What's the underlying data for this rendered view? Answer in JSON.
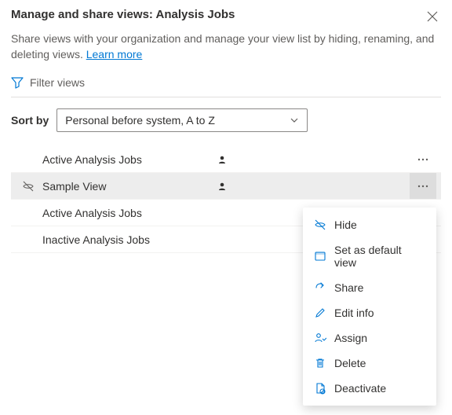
{
  "header": {
    "title": "Manage and share views: Analysis Jobs",
    "description_pre": "Share views with your organization and manage your view list by hiding, renaming, and deleting views. ",
    "learn_more": "Learn more"
  },
  "filter": {
    "label": "Filter views"
  },
  "sort": {
    "label": "Sort by",
    "selected": "Personal before system, A to Z"
  },
  "views": [
    {
      "label": "Active Analysis Jobs",
      "personal": true,
      "hidden": false,
      "more_visible": true,
      "hovered": false
    },
    {
      "label": "Sample View",
      "personal": true,
      "hidden": true,
      "more_visible": true,
      "hovered": true
    },
    {
      "label": "Active Analysis Jobs",
      "personal": false,
      "hidden": false,
      "more_visible": false,
      "hovered": false
    },
    {
      "label": "Inactive Analysis Jobs",
      "personal": false,
      "hidden": false,
      "more_visible": false,
      "hovered": false
    }
  ],
  "context_menu": {
    "items": [
      {
        "icon": "hide-icon",
        "label": "Hide"
      },
      {
        "icon": "default-icon",
        "label": "Set as default view"
      },
      {
        "icon": "share-icon",
        "label": "Share"
      },
      {
        "icon": "edit-icon",
        "label": "Edit info"
      },
      {
        "icon": "assign-icon",
        "label": "Assign"
      },
      {
        "icon": "delete-icon",
        "label": "Delete"
      },
      {
        "icon": "deactivate-icon",
        "label": "Deactivate"
      }
    ]
  }
}
